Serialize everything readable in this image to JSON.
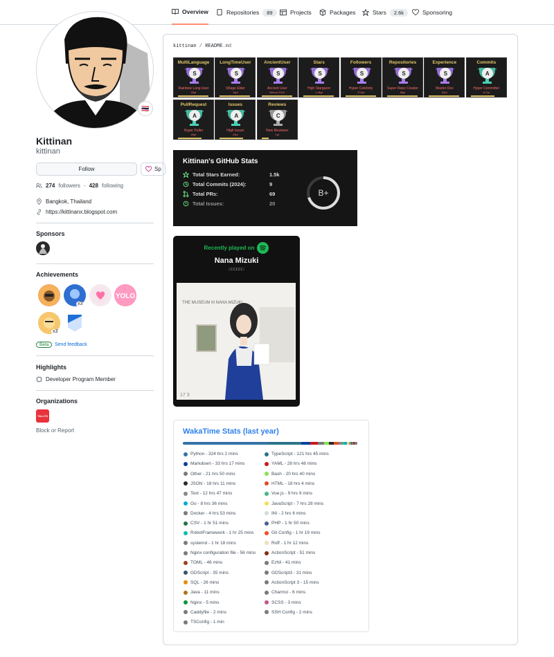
{
  "nav": {
    "tabs": [
      {
        "label": "Overview",
        "count": ""
      },
      {
        "label": "Repositories",
        "count": "89"
      },
      {
        "label": "Projects",
        "count": ""
      },
      {
        "label": "Packages",
        "count": ""
      },
      {
        "label": "Stars",
        "count": "2.6k"
      },
      {
        "label": "Sponsoring",
        "count": ""
      }
    ]
  },
  "profile": {
    "name": "Kittinan",
    "login": "kittinan",
    "follow": "Follow",
    "sponsor": "Sp",
    "followers": "274",
    "followers_label": "followers",
    "following": "428",
    "following_label": "following",
    "location": "Bangkok, Thailand",
    "website": "https://kittinanx.blogspot.com",
    "flag": "🇹🇭"
  },
  "sponsors": {
    "title": "Sponsors"
  },
  "achievements": {
    "title": "Achievements",
    "beta": "Beta",
    "feedback": "Send feedback",
    "x3a": "x3",
    "x3b": "x3",
    "badge_text": "YOLO"
  },
  "highlights": {
    "title": "Highlights",
    "item": "Developer Program Member"
  },
  "orgs": {
    "title": "Organizations",
    "block": "Block or Report",
    "org_text": "TALLTH"
  },
  "readme": {
    "user": "kittinan",
    "sep": " / ",
    "file": "README",
    ".md": ".md"
  },
  "trophies": [
    {
      "title": "MultiLanguage",
      "rank": "S",
      "sub": "Rainbow Lang User",
      "pt": "29pt"
    },
    {
      "title": "LongTimeUser",
      "rank": "S",
      "sub": "Village Elder",
      "pt": "14pt"
    },
    {
      "title": "AncientUser",
      "rank": "S",
      "sub": "Ancient User",
      "pt": "Before 2010"
    },
    {
      "title": "Stars",
      "rank": "S",
      "sub": "High Stargazer",
      "pt": "1.5kpt"
    },
    {
      "title": "Followers",
      "rank": "S",
      "sub": "Hyper Celebrity",
      "pt": "274pt"
    },
    {
      "title": "Repositories",
      "rank": "S",
      "sub": "Super Repo Creator",
      "pt": "86pt"
    },
    {
      "title": "Experience",
      "rank": "S",
      "sub": "Master Dev",
      "pt": "52pt"
    },
    {
      "title": "Commits",
      "rank": "A",
      "sub": "Hyper Committer",
      "pt": "417pt"
    },
    {
      "title": "PullRequest",
      "rank": "A",
      "sub": "Hyper Puller",
      "pt": "69pt"
    },
    {
      "title": "Issues",
      "rank": "A",
      "sub": "High Issuer",
      "pt": "20pt"
    },
    {
      "title": "Reviews",
      "rank": "C",
      "sub": "New Reviewer",
      "pt": "1pt"
    }
  ],
  "stats": {
    "title": "Kittinan's GitHub Stats",
    "rows": [
      {
        "label": "Total Stars Earned:",
        "value": "1.5k"
      },
      {
        "label": "Total Commits (2024):",
        "value": "9"
      },
      {
        "label": "Total PRs:",
        "value": "69"
      },
      {
        "label": "Total Issues:",
        "value": "20"
      }
    ],
    "grade": "B+",
    "grade_progress": 0.7
  },
  "spotify": {
    "header": "Recently played on",
    "artist": "Nana Mizuki",
    "track": "□□□□□□",
    "album_text": "THE MUSEUM III NANA MIZUKI",
    "album_num": "17 3"
  },
  "waka": {
    "title": "WakaTime Stats (last year)",
    "langs": [
      {
        "name": "Python - 324 hrs 2 mins",
        "color": "#3572A5",
        "share": 0.29
      },
      {
        "name": "TypeScript - 121 hrs 45 mins",
        "color": "#2b7489",
        "share": 0.11
      },
      {
        "name": "Markdown - 33 hrs 17 mins",
        "color": "#083fa1",
        "share": 0.03
      },
      {
        "name": "YAML - 28 hrs 48 mins",
        "color": "#cb171e",
        "share": 0.026
      },
      {
        "name": "Other - 21 hrs 50 mins",
        "color": "#7a7a7a",
        "share": 0.02
      },
      {
        "name": "Bash - 20 hrs 40 mins",
        "color": "#89e051",
        "share": 0.018
      },
      {
        "name": "JSON - 18 hrs 11 mins",
        "color": "#292929",
        "share": 0.016
      },
      {
        "name": "HTML - 18 hrs 4 mins",
        "color": "#e34c26",
        "share": 0.016
      },
      {
        "name": "Text - 12 hrs 47 mins",
        "color": "#888888",
        "share": 0.011
      },
      {
        "name": "Vue.js - 9 hrs 9 mins",
        "color": "#41b883",
        "share": 0.008
      },
      {
        "name": "Go - 8 hrs 36 mins",
        "color": "#00ADD8",
        "share": 0.008
      },
      {
        "name": "JavaScript - 7 hrs 28 mins",
        "color": "#f1e05a",
        "share": 0.007
      },
      {
        "name": "Docker - 4 hrs 53 mins",
        "color": "#7a7a7a",
        "share": 0.004
      },
      {
        "name": "INI - 2 hrs 6 mins",
        "color": "#d1dbe0",
        "share": 0.002
      },
      {
        "name": "CSV - 1 hr 51 mins",
        "color": "#237346",
        "share": 0.002
      },
      {
        "name": "PHP - 1 hr 50 mins",
        "color": "#4F5D95",
        "share": 0.002
      },
      {
        "name": "RobotFramework - 1 hr 25 mins",
        "color": "#00c0b5",
        "share": 0.001
      },
      {
        "name": "Git Config - 1 hr 19 mins",
        "color": "#F44D27",
        "share": 0.001
      },
      {
        "name": "systemd - 1 hr 18 mins",
        "color": "#7a7a7a",
        "share": 0.001
      },
      {
        "name": "Roff - 1 hr 12 mins",
        "color": "#ecdebe",
        "share": 0.001
      },
      {
        "name": "Nginx configuration file - 56 mins",
        "color": "#7a7a7a",
        "share": 0.001
      },
      {
        "name": "ActionScript - 51 mins",
        "color": "#882B0F",
        "share": 0.001
      },
      {
        "name": "TOML - 46 mins",
        "color": "#9c4221",
        "share": 0.001
      },
      {
        "name": "Ezhil - 41 mins",
        "color": "#7a7a7a",
        "share": 0.001
      },
      {
        "name": "GDScript - 35 mins",
        "color": "#355570",
        "share": 0.001
      },
      {
        "name": "GDScript3 - 31 mins",
        "color": "#7a7a7a",
        "share": 0.001
      },
      {
        "name": "SQL - 26 mins",
        "color": "#e38c00",
        "share": 0.001
      },
      {
        "name": "ActionScript 3 - 15 mins",
        "color": "#7a7a7a",
        "share": 0.001
      },
      {
        "name": "Java - 11 mins",
        "color": "#b07219",
        "share": 0.001
      },
      {
        "name": "Charmci - 6 mins",
        "color": "#7a7a7a",
        "share": 0.001
      },
      {
        "name": "Nginx - 5 mins",
        "color": "#009639",
        "share": 0.001
      },
      {
        "name": "SCSS - 3 mins",
        "color": "#c6538c",
        "share": 0.001
      },
      {
        "name": "Caddyfile - 2 mins",
        "color": "#7a7a7a",
        "share": 0.001
      },
      {
        "name": "SSH Config - 2 mins",
        "color": "#7a7a7a",
        "share": 0.001
      },
      {
        "name": "TSConfig - 1 min",
        "color": "#7a7a7a",
        "share": 0.001
      }
    ]
  }
}
